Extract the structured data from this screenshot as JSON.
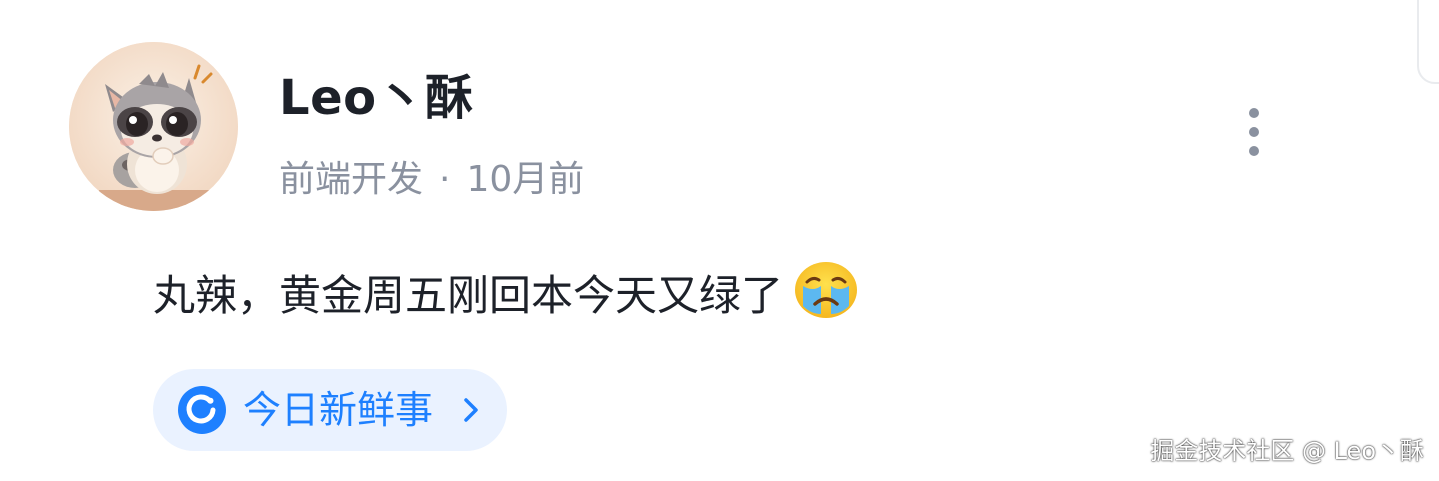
{
  "post": {
    "author": {
      "name": "Leo丶酥",
      "avatar": "raccoon-cartoon-avatar"
    },
    "meta": {
      "job_title": "前端开发",
      "separator": "·",
      "time": "10月前"
    },
    "content": {
      "text": "丸辣，黄金周五刚回本今天又绿了",
      "emoji": "crying-face-emoji"
    },
    "topic": {
      "label": "今日新鲜事",
      "icon": "topic-circle-icon",
      "color": "#1e80ff",
      "background": "#eaf2ff"
    },
    "more_menu_icon": "more-vertical-icon"
  },
  "watermark": {
    "text": "掘金技术社区 @ Leo丶酥"
  }
}
